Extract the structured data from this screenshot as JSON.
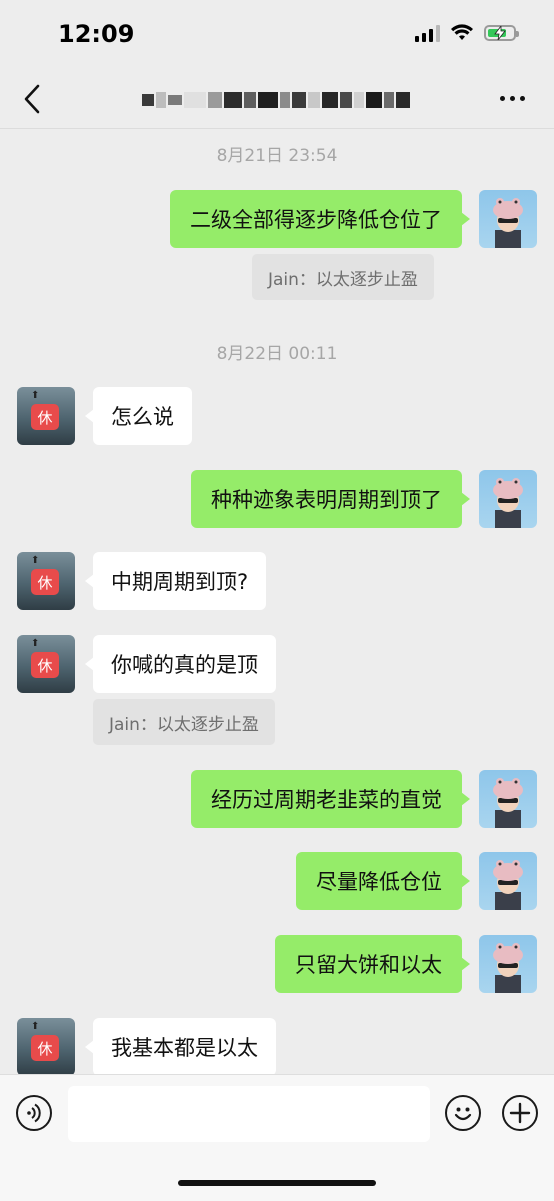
{
  "status": {
    "time": "12:09"
  },
  "nav": {
    "back_icon": "chevron-left-icon",
    "more_icon": "more-dots-icon"
  },
  "messages": {
    "ts1": "8月21日 23:54",
    "m1": "二级全部得逐步降低仓位了",
    "q1": "Jain：以太逐步止盈",
    "ts2": "8月22日 00:11",
    "m2": "怎么说",
    "m3": "种种迹象表明周期到顶了",
    "m4": "中期周期到顶?",
    "m5": "你喊的真的是顶",
    "q2": "Jain：以太逐步止盈",
    "m6": "经历过周期老韭菜的直觉",
    "m7": "尽量降低仓位",
    "m8": "只留大饼和以太",
    "m9": "我基本都是以太"
  },
  "avatars": {
    "other_badge": "休"
  },
  "input": {
    "value": "",
    "voice_icon": "voice-icon",
    "emoji_icon": "emoji-icon",
    "plus_icon": "plus-icon"
  },
  "colors": {
    "my_bubble": "#95ec69",
    "other_bubble": "#ffffff",
    "background": "#ededed",
    "badge": "#e84b4b"
  }
}
